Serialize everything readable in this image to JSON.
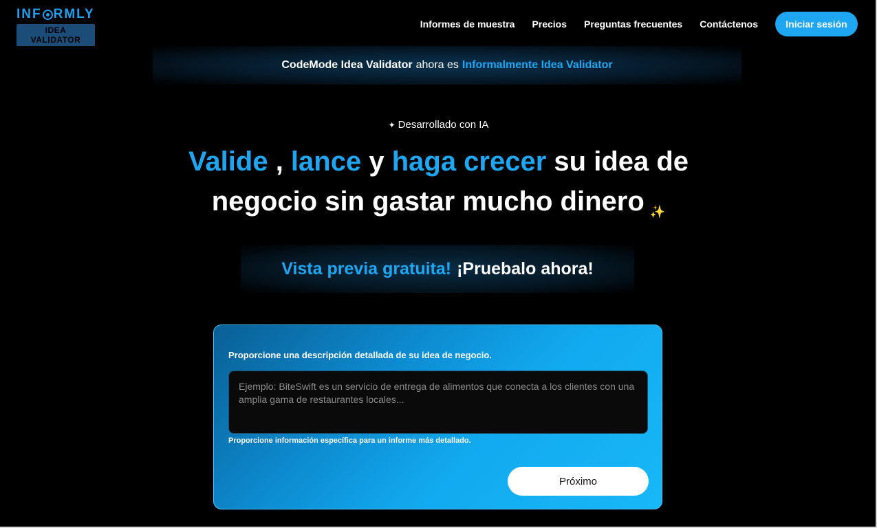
{
  "logo": {
    "word_start": "INF",
    "word_end": "RMLY",
    "badge": "IDEA VALIDATOR"
  },
  "nav": {
    "links": [
      "Informes de muestra",
      "Precios",
      "Preguntas frecuentes",
      "Contáctenos"
    ],
    "login": "Iniciar sesión"
  },
  "announcement": {
    "old_name": "CodeMode Idea Validator",
    "middle": "ahora es",
    "new_name": "Informalmente Idea Validator"
  },
  "hero": {
    "ai_tag": "Desarrollado con IA",
    "headline": {
      "w1": "Valide",
      "sep1": " , ",
      "w2": "lance",
      "sep2": " y ",
      "w3": "haga crecer",
      "rest1": " su idea de",
      "rest2": "negocio sin gastar mucho dinero"
    },
    "preview_blue": "Vista previa gratuita!",
    "preview_white": "¡Pruebalo ahora!"
  },
  "form": {
    "label": "Proporcione una descripción detallada de su idea de negocio.",
    "placeholder": "Ejemplo: BiteSwift es un servicio de entrega de alimentos que conecta a los clientes con una amplia gama de restaurantes locales...",
    "value": "",
    "hint": "Proporcione información específica para un informe más detallado.",
    "next_button": "Próximo"
  },
  "colors": {
    "accent": "#1ea6f2",
    "background": "#000000",
    "sparkle": "#f2c94c"
  },
  "icons": {
    "ai_tag": "sparkle-icon",
    "headline_end": "sparkles-icon"
  }
}
